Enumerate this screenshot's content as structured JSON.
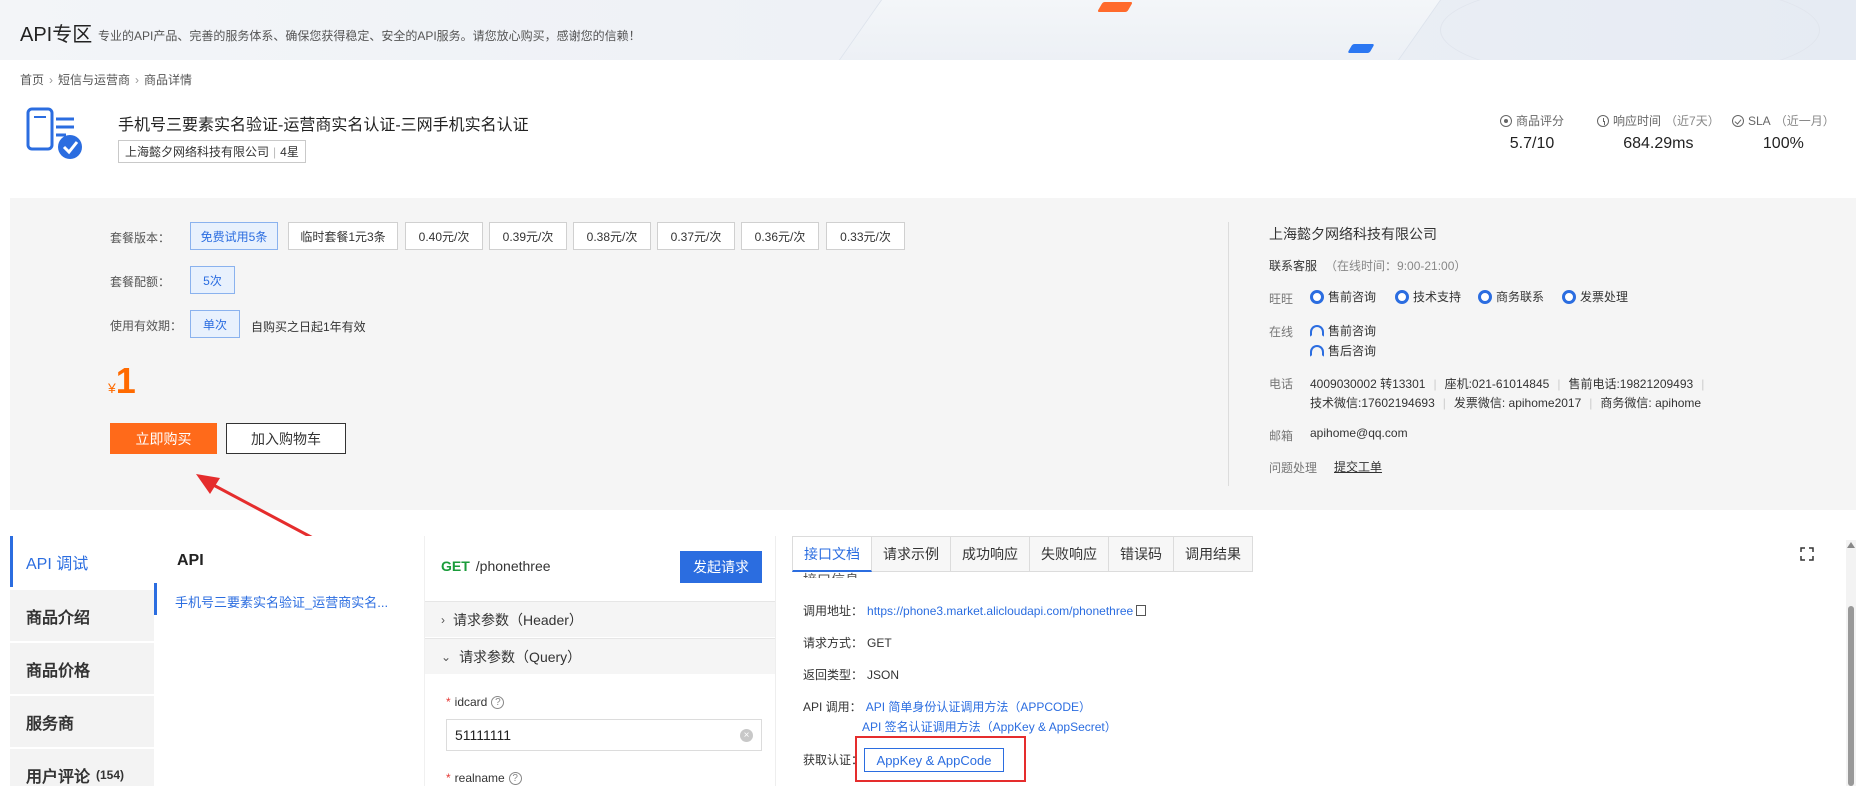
{
  "header": {
    "title": "API专区",
    "description": "专业的API产品、完善的服务体系、确保您获得稳定、安全的API服务。请您放心购买，感谢您的信赖！"
  },
  "breadcrumb": [
    "首页",
    "短信与运营商",
    "商品详情"
  ],
  "product": {
    "title": "手机号三要素实名验证-运营商实名认证-三网手机实名认证",
    "vendor": "上海懿夕网络科技有限公司",
    "vendor_level": "4星",
    "stats": [
      {
        "label": "商品评分",
        "hint": "",
        "value": "5.7/10"
      },
      {
        "label": "响应时间",
        "hint": "（近7天）",
        "value": "684.29ms"
      },
      {
        "label": "SLA",
        "hint": "（近一月）",
        "value": "100%"
      }
    ]
  },
  "purchase": {
    "version_label": "套餐版本：",
    "versions": [
      "免费试用5条",
      "临时套餐1元3条",
      "0.40元/次",
      "0.39元/次",
      "0.38元/次",
      "0.37元/次",
      "0.36元/次",
      "0.33元/次"
    ],
    "quota_label": "套餐配额：",
    "quota": "5次",
    "validity_label": "使用有效期：",
    "validity": "单次",
    "validity_text": "自购买之日起1年有效",
    "currency": "¥",
    "price": "1",
    "buy_label": "立即购买",
    "cart_label": "加入购物车"
  },
  "service": {
    "vendor_name": "上海懿夕网络科技有限公司",
    "contact_title": "联系客服",
    "contact_hours": "（在线时间：9:00-21:00）",
    "wangwang_label": "旺旺",
    "wangwang_items": [
      "售前咨询",
      "技术支持",
      "商务联系",
      "发票处理"
    ],
    "online_label": "在线",
    "online_items": [
      "售前咨询",
      "售后咨询"
    ],
    "phone_label": "电话",
    "phone_line1": [
      "4009030002 转13301",
      "座机:021-61014845",
      "售前电话:19821209493"
    ],
    "phone_line2": [
      "技术微信:17602194693",
      "发票微信: apihome2017",
      "商务微信: apihome"
    ],
    "mail_label": "邮箱",
    "mail": "apihome@qq.com",
    "issue_label": "问题处理",
    "issue_link": "提交工单"
  },
  "side_nav": [
    {
      "label": "API 调试",
      "count": ""
    },
    {
      "label": "商品介绍",
      "count": ""
    },
    {
      "label": "商品价格",
      "count": ""
    },
    {
      "label": "服务商",
      "count": ""
    },
    {
      "label": "用户评论",
      "count": "(154)"
    }
  ],
  "api_list": {
    "title": "API",
    "item": "手机号三要素实名验证_运营商实名..."
  },
  "request": {
    "method": "GET",
    "path": "/phonethree",
    "send_label": "发起请求",
    "header_section": "请求参数（Header）",
    "query_section": "请求参数（Query）",
    "param1_name": "idcard",
    "param1_value": "51111111",
    "param2_name": "realname"
  },
  "doc": {
    "tabs": [
      "接口文档",
      "请求示例",
      "成功响应",
      "失败响应",
      "错误码",
      "调用结果"
    ],
    "cut_heading": "接口信息",
    "url_label": "调用地址：",
    "url": "https://phone3.market.alicloudapi.com/phonethree",
    "method_label": "请求方式：",
    "method": "GET",
    "return_label": "返回类型：",
    "return_type": "JSON",
    "call_label": "API 调用：",
    "call_link1": "API 简单身份认证调用方法（APPCODE）",
    "call_link2": "API 签名认证调用方法（AppKey & AppSecret）",
    "auth_label": "获取认证：",
    "auth_button": "AppKey & AppCode"
  },
  "colors": {
    "accent": "#2b6de0",
    "buy": "#ff6a1a",
    "price": "#ff6a00",
    "highlight": "#e52d2d"
  }
}
